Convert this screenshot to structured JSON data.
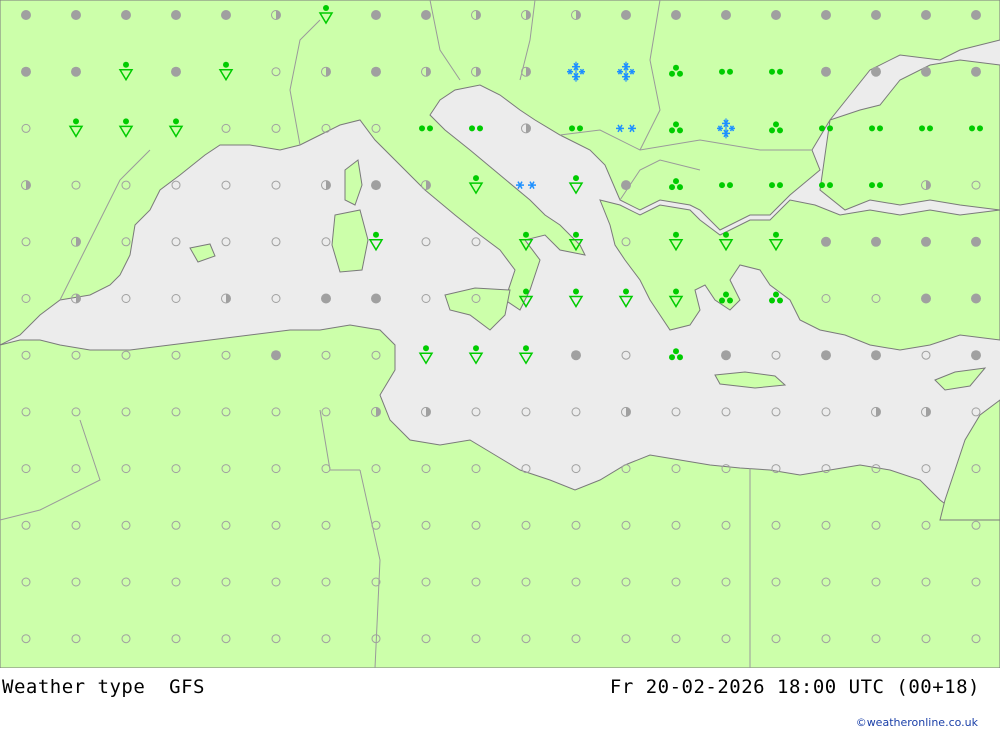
{
  "title": "Weather type",
  "model": "GFS",
  "valid_time": "Fr 20-02-2026 18:00 UTC (00+18)",
  "credit": "©weatheronline.co.uk",
  "colors": {
    "land": "#ccffaa",
    "sea": "#ececec",
    "border": "#9a9a9a",
    "coast": "#7a7a7a",
    "rain": "#00cc00",
    "snow": "#1e90ff",
    "cloud": "#a0a0a0"
  },
  "grid": {
    "lons": [
      -9.0,
      -7.0,
      -5.0,
      -3.0,
      -1.0,
      1.0,
      3.0,
      5.0,
      7.0,
      9.0,
      11.0,
      13.0,
      15.0,
      17.0,
      19.0,
      21.0,
      23.0,
      25.0,
      27.0,
      29.0,
      31.0,
      33.0,
      35.0,
      37.0,
      39.0,
      41.0
    ],
    "lats": [
      47.0,
      45.5,
      44.0,
      42.5,
      41.0,
      39.5,
      38.0,
      36.5,
      35.0,
      33.5,
      32.0,
      30.5
    ],
    "legend": {
      "F": "fair",
      "P": "partly cloudy",
      "O": "overcast",
      "D": "rain drops",
      "S": "rain showers",
      "SN": "snow showers",
      "T": "three drops",
      "N": "snow",
      "NS": "heavy snow",
      "X": "star-snow"
    },
    "rows": [
      "OOOOOPSOOPPPOOOOOOOOOO",
      "OOSOSFPOPPPNNTDDOOOOOO",
      "FSSSFFFFDDPDXTNTDDDDDP",
      "PFFFFFPOPSXSOTDDDDPFFO",
      "FPFFFFFSFFSSFSSSOOOOFO",
      "FPFFPFOOFFSSSSTTFFOOFO",
      "FFFFFOFFSSSOFTOFOOFOFF",
      "FFFFFFFPPFFFPFFFFPPFFF",
      "FFFFFFFFFFFFFFFFFFFFFF",
      "FFFFFFFFFFFFFFFFFFFFFF",
      "FFFFFFFFFFFFFFFFFFFFFF",
      "FFFFFFFFFFFFFFFFFFFFFF"
    ]
  }
}
